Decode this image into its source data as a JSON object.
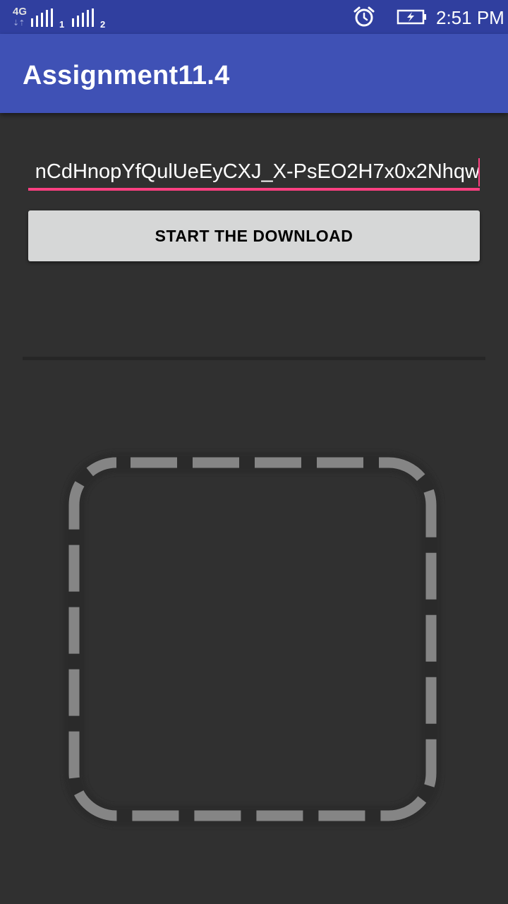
{
  "status_bar": {
    "network_type": "4G",
    "network_arrows": "⇣⇡",
    "sim1_label": "1",
    "sim2_label": "2",
    "time": "2:51 PM",
    "icons": [
      "signal-icon",
      "alarm-icon",
      "battery-charging-icon"
    ]
  },
  "toolbar": {
    "title": "Assignment11.4"
  },
  "url_field": {
    "value": "nCdHnopYfQulUeEyCXJ_X-PsEO2H7x0x2Nhqw"
  },
  "download_button": {
    "label": "START THE DOWNLOAD"
  },
  "image_view": {
    "icon": "image-placeholder-icon"
  },
  "colors": {
    "status_bar": "#303f9f",
    "toolbar": "#3f51b5",
    "accent": "#ff4081",
    "background": "#303030",
    "button": "#d6d7d7"
  }
}
